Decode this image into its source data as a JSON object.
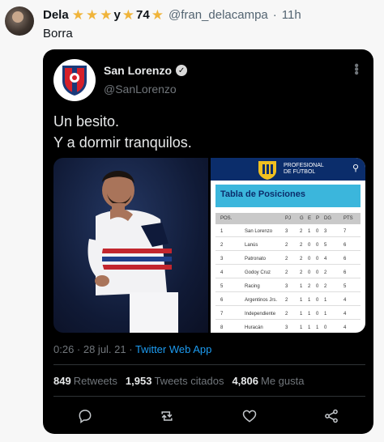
{
  "outer": {
    "display_name": "Dela",
    "name_y": "y",
    "name_74": "74",
    "handle": "@fran_delacampa",
    "separator": "·",
    "time": "11h",
    "text": "Borra"
  },
  "quoted": {
    "name": "San Lorenzo",
    "handle": "@SanLorenzo",
    "text_line1": "Un besito.",
    "text_line2": "Y a dormir tranquilos.",
    "time": "0:26 · 28 jul. 21 ·",
    "source": "Twitter Web App",
    "retweets_count": "849",
    "retweets_label": "Retweets",
    "quotes_count": "1,953",
    "quotes_label": "Tweets citados",
    "likes_count": "4,806",
    "likes_label": "Me gusta"
  },
  "table_image": {
    "header_brand_line1": "PROFESIONAL",
    "header_brand_line2": "DE FÚTBOL",
    "title": "Tabla de Posiciones",
    "columns": [
      "POS.",
      "",
      "PJ",
      "G",
      "E",
      "P",
      "DG",
      "PTS"
    ],
    "rows": [
      [
        "1",
        "San Lorenzo",
        "3",
        "2",
        "1",
        "0",
        "3",
        "7"
      ],
      [
        "2",
        "Lanús",
        "2",
        "2",
        "0",
        "0",
        "5",
        "6"
      ],
      [
        "3",
        "Patronato",
        "2",
        "2",
        "0",
        "0",
        "4",
        "6"
      ],
      [
        "4",
        "Godoy Cruz",
        "2",
        "2",
        "0",
        "0",
        "2",
        "6"
      ],
      [
        "5",
        "Racing",
        "3",
        "1",
        "2",
        "0",
        "2",
        "5"
      ],
      [
        "6",
        "Argentinos Jrs.",
        "2",
        "1",
        "1",
        "0",
        "1",
        "4"
      ],
      [
        "7",
        "Independiente",
        "2",
        "1",
        "1",
        "0",
        "1",
        "4"
      ],
      [
        "8",
        "Huracán",
        "3",
        "1",
        "1",
        "1",
        "0",
        "4"
      ]
    ]
  },
  "colors": {
    "link": "#1d9bf0",
    "star": "#f0b43a",
    "card_bg": "#000000"
  },
  "icons": [
    "star-icon",
    "verified-icon",
    "more-icon",
    "reply-icon",
    "retweet-icon",
    "like-icon",
    "share-icon"
  ]
}
